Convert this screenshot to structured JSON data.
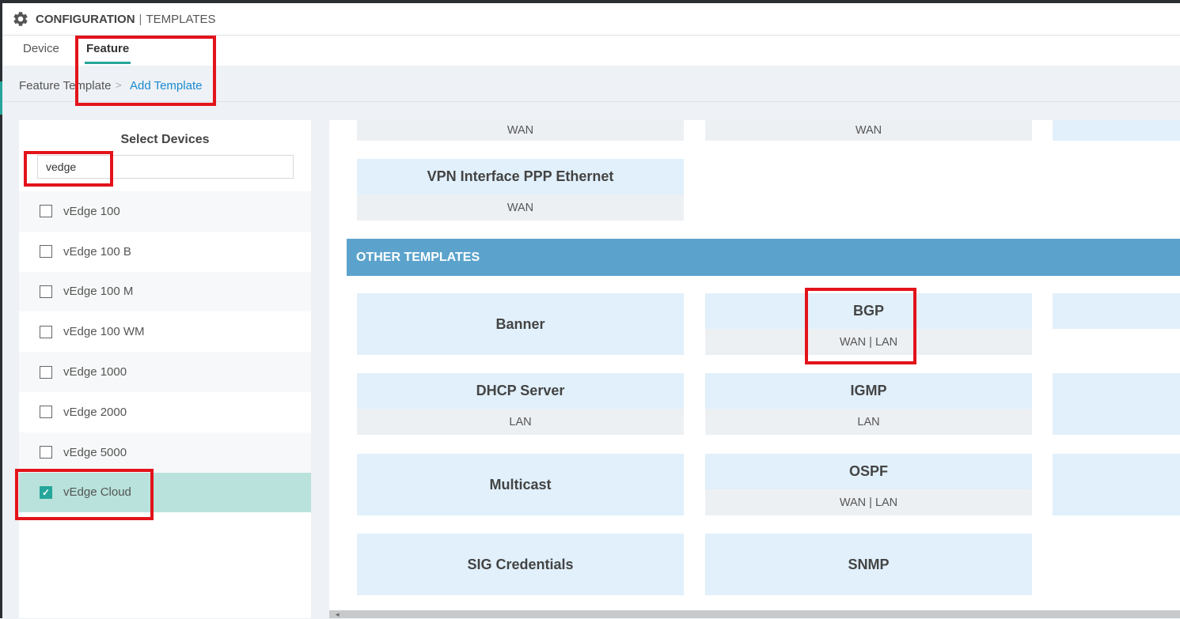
{
  "header": {
    "title": "CONFIGURATION",
    "separator": "|",
    "subtitle": "TEMPLATES"
  },
  "tabs": [
    {
      "label": "Device"
    },
    {
      "label": "Feature"
    }
  ],
  "breadcrumb": {
    "parent": "Feature Template",
    "chevron": ">",
    "current": "Add Template"
  },
  "select_devices": {
    "title": "Select Devices",
    "search_value": "vedge",
    "devices": [
      {
        "label": "vEdge 100",
        "checked": false
      },
      {
        "label": "vEdge 100 B",
        "checked": false
      },
      {
        "label": "vEdge 100 M",
        "checked": false
      },
      {
        "label": "vEdge 100 WM",
        "checked": false
      },
      {
        "label": "vEdge 1000",
        "checked": false
      },
      {
        "label": "vEdge 2000",
        "checked": false
      },
      {
        "label": "vEdge 5000",
        "checked": false
      },
      {
        "label": "vEdge Cloud",
        "checked": true
      }
    ],
    "check_mark": "✓"
  },
  "vpn_section": {
    "top_tags": [
      "WAN",
      "WAN"
    ],
    "ppp_card": {
      "name": "VPN Interface PPP Ethernet",
      "tag": "WAN"
    }
  },
  "other_templates": {
    "heading": "OTHER TEMPLATES",
    "cards": {
      "banner": {
        "name": "Banner"
      },
      "bgp": {
        "name": "BGP",
        "tag": "WAN | LAN"
      },
      "dhcp": {
        "name": "DHCP Server",
        "tag": "LAN"
      },
      "igmp": {
        "name": "IGMP",
        "tag": "LAN"
      },
      "multicast": {
        "name": "Multicast"
      },
      "ospf": {
        "name": "OSPF",
        "tag": "WAN | LAN"
      },
      "sig": {
        "name": "SIG Credentials"
      },
      "snmp": {
        "name": "SNMP"
      }
    }
  },
  "scrollbar": {
    "left_arrow": "◂"
  },
  "colors": {
    "accent": "#26a69a",
    "section_header": "#5ba3cc",
    "card_bg": "#e1f0fb",
    "link": "#1a8bd0",
    "highlight_box": "#e3131b"
  }
}
